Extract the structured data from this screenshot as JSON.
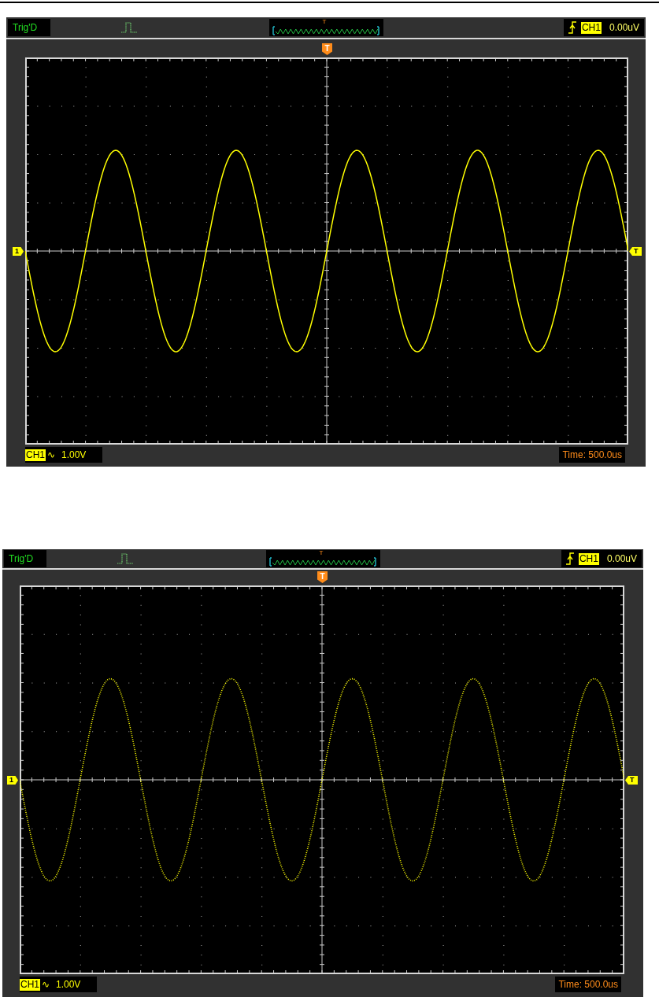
{
  "scopes": [
    {
      "status": "Trig'D",
      "trigger_channel": "CH1",
      "trigger_level": "0.00uV",
      "trigger_marker": "T",
      "preview_marker": "T",
      "channel_marker": "1",
      "level_marker": "T",
      "channel": "CH1",
      "coupling": "∿",
      "volts_per_div": "1.00V",
      "timebase": "Time: 500.0us",
      "trace": {
        "kind": "line"
      }
    },
    {
      "status": "Trig'D",
      "trigger_channel": "CH1",
      "trigger_level": "0.00uV",
      "trigger_marker": "T",
      "preview_marker": "T",
      "channel_marker": "1",
      "level_marker": "T",
      "channel": "CH1",
      "coupling": "∿",
      "volts_per_div": "1.00V",
      "timebase": "Time: 500.0us",
      "trace": {
        "kind": "dots"
      }
    }
  ]
}
